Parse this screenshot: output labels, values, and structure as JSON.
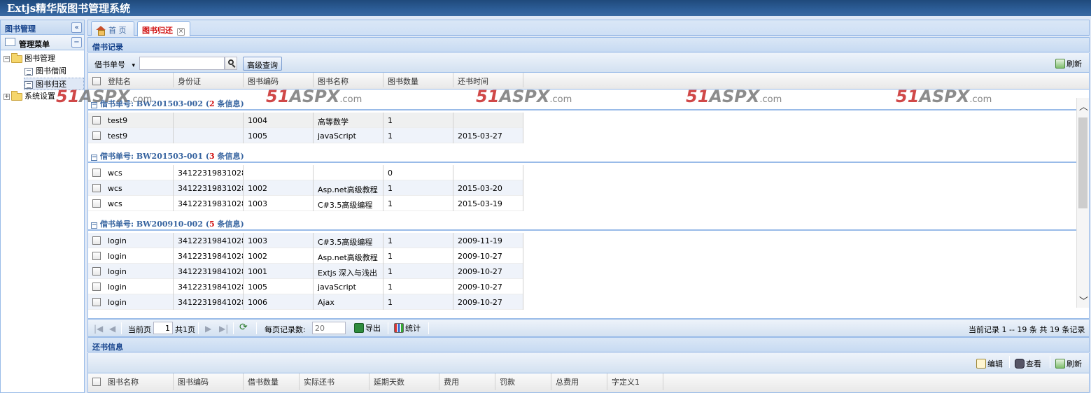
{
  "app": {
    "title": "Extjs精华版图书管理系统"
  },
  "west": {
    "title": "图书管理",
    "collapse_glyph": "«",
    "menu_title": "管理菜单",
    "menu_collapse_glyph": "−",
    "tree": [
      {
        "label": "图书管理",
        "expanded": true,
        "children": [
          "图书借阅",
          "图书归还"
        ]
      },
      {
        "label": "系统设置",
        "expanded": false
      }
    ]
  },
  "tabs": [
    {
      "label": "首 页",
      "icon": "home-icon",
      "active": false
    },
    {
      "label": "图书归还",
      "active": true,
      "closable": true,
      "close_glyph": "×"
    }
  ],
  "borrow_panel": {
    "title": "借书记录",
    "search_field_label": "借书单号",
    "dropdown_glyph": "▾",
    "search_value": "",
    "advanced_label": "高级查询",
    "refresh_label": "刷新",
    "columns": [
      "登陆名",
      "身份证",
      "图书编码",
      "图书名称",
      "图书数量",
      "还书时间"
    ],
    "groups": [
      {
        "prefix": "借书单号: BW201503-002 (",
        "count": "2",
        "suffix": " 条信息)",
        "rows": [
          [
            "test9",
            "",
            "1004",
            "高等数学",
            "1",
            ""
          ],
          [
            "test9",
            "",
            "1005",
            "javaScript",
            "1",
            "2015-03-27"
          ]
        ]
      },
      {
        "prefix": "借书单号: BW201503-001 (",
        "count": "3",
        "suffix": " 条信息)",
        "rows": [
          [
            "wcs",
            "34122319831028...",
            "",
            "",
            "0",
            ""
          ],
          [
            "wcs",
            "34122319831028...",
            "1002",
            "Asp.net高级教程",
            "1",
            "2015-03-20"
          ],
          [
            "wcs",
            "34122319831028...",
            "1003",
            "C#3.5高级编程",
            "1",
            "2015-03-19"
          ]
        ]
      },
      {
        "prefix": "借书单号: BW200910-002 (",
        "count": "5",
        "suffix": " 条信息)",
        "rows": [
          [
            "login",
            "34122319841028...",
            "1003",
            "C#3.5高级编程",
            "1",
            "2009-11-19"
          ],
          [
            "login",
            "34122319841028...",
            "1002",
            "Asp.net高级教程",
            "1",
            "2009-10-27"
          ],
          [
            "login",
            "34122319841028...",
            "1001",
            "Extjs 深入与浅出",
            "1",
            "2009-10-27"
          ],
          [
            "login",
            "34122319841028...",
            "1005",
            "javaScript",
            "1",
            "2009-10-27"
          ],
          [
            "login",
            "34122319841028...",
            "1006",
            "Ajax",
            "1",
            "2009-10-27"
          ]
        ]
      }
    ],
    "pager": {
      "current_label": "当前页",
      "page": "1",
      "total_pages": "共1页",
      "page_size_label": "每页记录数:",
      "page_size_placeholder": "20",
      "export_label": "导出",
      "stats_label": "统计",
      "summary": "当前记录  1 -- 19 条  共  19 条记录"
    }
  },
  "return_panel": {
    "title": "还书信息",
    "edit_label": "编辑",
    "view_label": "查看",
    "refresh_label": "刷新",
    "columns": [
      "图书名称",
      "图书编码",
      "借书数量",
      "实际还书",
      "延期天数",
      "费用",
      "罚款",
      "总费用",
      "字定义1"
    ]
  },
  "watermark": {
    "digits": "51",
    "brand": "ASPX",
    "suffix": ".com"
  },
  "colors": {
    "title_bar": "#2d5e98",
    "panel_header_text": "#15428b",
    "active_tab": "#d01010",
    "group_count": "#d01010",
    "group_text": "#3764a0"
  }
}
